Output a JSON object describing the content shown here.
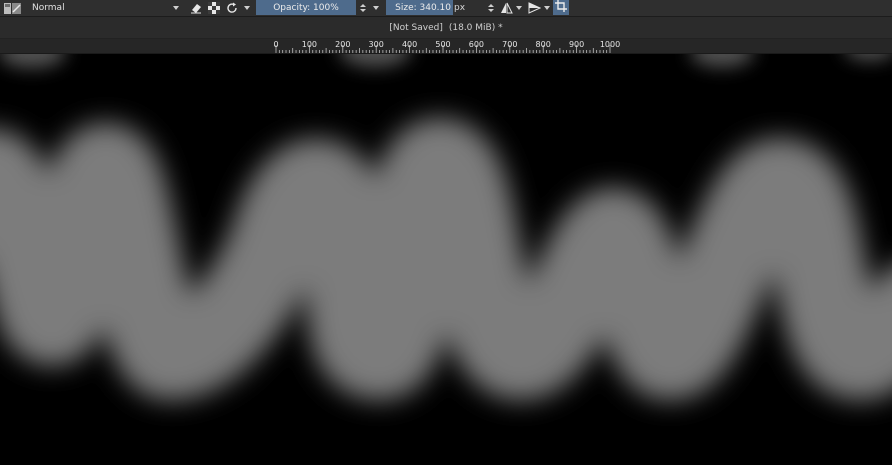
{
  "toolbar": {
    "blend_mode": "Normal",
    "opacity_label": "Opacity: 100%",
    "size_label": "Size: 340.10",
    "size_unit": "px",
    "icons": [
      "brush-preset-icon",
      "eraser-icon",
      "alpha-lock-icon",
      "reload-icon",
      "mirror-horizontal-icon",
      "mirror-vertical-icon",
      "wrap-around-icon"
    ]
  },
  "document": {
    "status": "[Not Saved]",
    "size": "(18.0 MiB) *"
  },
  "ruler": {
    "labels": [
      "0",
      "100",
      "200",
      "300",
      "400",
      "500",
      "600",
      "700",
      "800",
      "900",
      "1000"
    ]
  },
  "canvas": {
    "background": "#000000",
    "stroke_color": "#7b7b7b"
  }
}
